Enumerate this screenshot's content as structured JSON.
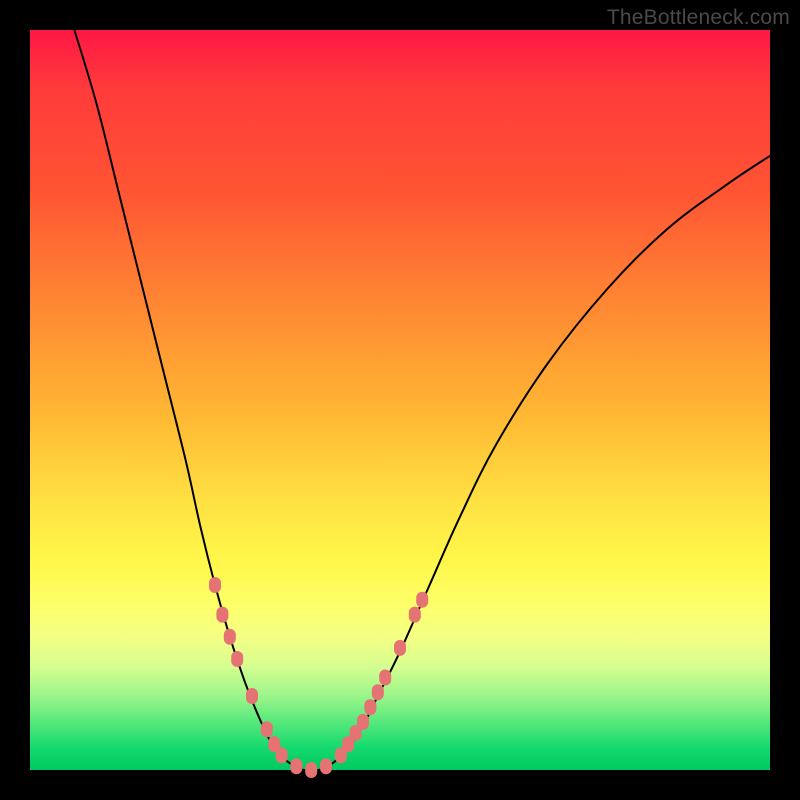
{
  "attribution": "TheBottleneck.com",
  "colors": {
    "gradient_top": "#ff1744",
    "gradient_mid": "#ffe243",
    "gradient_bottom": "#00c95f",
    "curve_stroke": "#000000",
    "marker_fill": "#e57373",
    "frame_bg": "#000000"
  },
  "chart_data": {
    "type": "line",
    "title": "",
    "xlabel": "",
    "ylabel": "",
    "xlim": [
      0,
      100
    ],
    "ylim": [
      0,
      100
    ],
    "curve_points": [
      {
        "x": 6,
        "y": 100
      },
      {
        "x": 9,
        "y": 90
      },
      {
        "x": 12,
        "y": 78
      },
      {
        "x": 15,
        "y": 66
      },
      {
        "x": 18,
        "y": 54
      },
      {
        "x": 21,
        "y": 42
      },
      {
        "x": 23,
        "y": 33
      },
      {
        "x": 25,
        "y": 25
      },
      {
        "x": 27,
        "y": 18
      },
      {
        "x": 29,
        "y": 12
      },
      {
        "x": 31,
        "y": 7
      },
      {
        "x": 33,
        "y": 3
      },
      {
        "x": 35,
        "y": 1
      },
      {
        "x": 37,
        "y": 0
      },
      {
        "x": 39,
        "y": 0
      },
      {
        "x": 41,
        "y": 1
      },
      {
        "x": 43,
        "y": 3
      },
      {
        "x": 45,
        "y": 6
      },
      {
        "x": 47,
        "y": 10
      },
      {
        "x": 50,
        "y": 16
      },
      {
        "x": 54,
        "y": 25
      },
      {
        "x": 58,
        "y": 34
      },
      {
        "x": 63,
        "y": 44
      },
      {
        "x": 70,
        "y": 55
      },
      {
        "x": 78,
        "y": 65
      },
      {
        "x": 86,
        "y": 73
      },
      {
        "x": 94,
        "y": 79
      },
      {
        "x": 100,
        "y": 83
      }
    ],
    "markers": [
      {
        "x": 25,
        "y": 25
      },
      {
        "x": 26,
        "y": 21
      },
      {
        "x": 27,
        "y": 18
      },
      {
        "x": 28,
        "y": 15
      },
      {
        "x": 30,
        "y": 10
      },
      {
        "x": 32,
        "y": 5.5
      },
      {
        "x": 33,
        "y": 3.5
      },
      {
        "x": 34,
        "y": 2
      },
      {
        "x": 36,
        "y": 0.5
      },
      {
        "x": 38,
        "y": 0
      },
      {
        "x": 40,
        "y": 0.5
      },
      {
        "x": 42,
        "y": 2
      },
      {
        "x": 43,
        "y": 3.5
      },
      {
        "x": 44,
        "y": 5
      },
      {
        "x": 45,
        "y": 6.5
      },
      {
        "x": 46,
        "y": 8.5
      },
      {
        "x": 47,
        "y": 10.5
      },
      {
        "x": 48,
        "y": 12.5
      },
      {
        "x": 50,
        "y": 16.5
      },
      {
        "x": 52,
        "y": 21
      },
      {
        "x": 53,
        "y": 23
      }
    ]
  }
}
